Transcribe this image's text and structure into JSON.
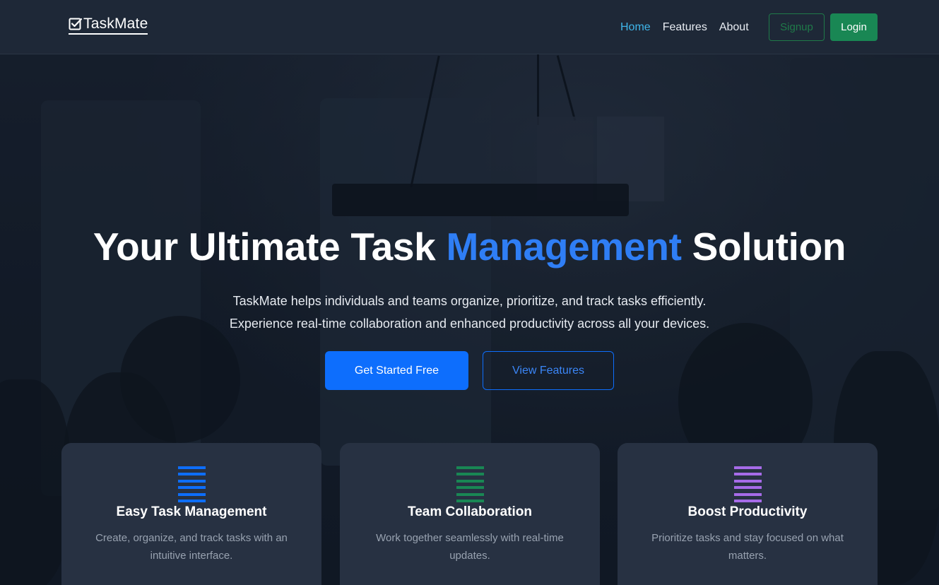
{
  "brand": {
    "name": "TaskMate",
    "icon": "checkbox-icon"
  },
  "nav": {
    "links": [
      {
        "label": "Home",
        "active": true
      },
      {
        "label": "Features",
        "active": false
      },
      {
        "label": "About",
        "active": false
      }
    ],
    "signup_label": "Signup",
    "login_label": "Login"
  },
  "hero": {
    "title_before": "Your Ultimate Task ",
    "title_accent": "Management",
    "title_after": " Solution",
    "subtitle_line1": "TaskMate helps individuals and teams organize, prioritize, and track tasks efficiently.",
    "subtitle_line2": "Experience real-time collaboration and enhanced productivity across all your devices.",
    "primary_cta": "Get Started Free",
    "secondary_cta": "View Features"
  },
  "features": [
    {
      "title": "Easy Task Management",
      "description": "Create, organize, and track tasks with an intuitive interface.",
      "icon": "list-icon",
      "color": "#0d6efd"
    },
    {
      "title": "Team Collaboration",
      "description": "Work together seamlessly with real-time updates.",
      "icon": "list-icon",
      "color": "#198754"
    },
    {
      "title": "Boost Productivity",
      "description": "Prioritize tasks and stay focused on what matters.",
      "icon": "list-icon",
      "color": "#a66be8"
    }
  ],
  "colors": {
    "accent": "#2f7ef5",
    "primary_button": "#0d6efd",
    "success": "#198754",
    "nav_active": "#3fb6ea",
    "navbar_bg": "#1e2837",
    "card_bg": "#273142"
  }
}
